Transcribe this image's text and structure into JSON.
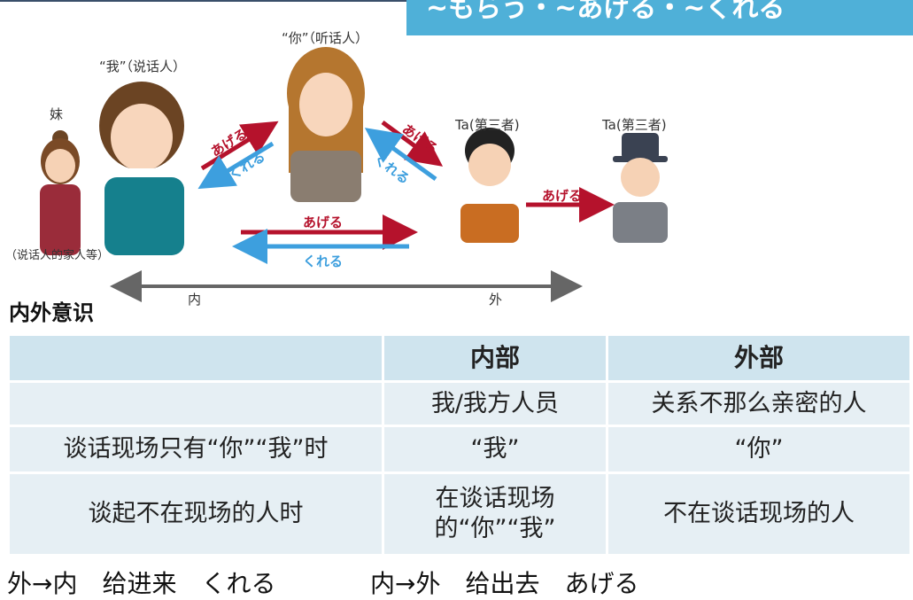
{
  "banner": {
    "title": "~もらう・~あげる・~くれる"
  },
  "figure": {
    "person_sister": "妹",
    "person_sister_note": "（说话人的家人等）",
    "person_me": "“我”（说话人）",
    "person_you": "“你”（听话人）",
    "person_third_1": "Ta(第三者)",
    "person_third_2": "Ta(第三者)",
    "arrow_ageru_1": "あげる",
    "arrow_kureru_1": "くれる",
    "arrow_ageru_2": "あげる",
    "arrow_kureru_2": "くれる",
    "arrow_ageru_3": "あげる",
    "arrow_kureru_3": "くれる",
    "arrow_ageru_4": "あげる",
    "scale_inner": "内",
    "scale_outer": "外"
  },
  "section_title": "内外意识",
  "table": {
    "headers": [
      "",
      "内部",
      "外部"
    ],
    "rows": [
      [
        "",
        "我/我方人员",
        "关系不那么亲密的人"
      ],
      [
        "谈话现场只有“你”“我”时",
        "“我”",
        "“你”"
      ],
      [
        "谈起不在现场的人时",
        "在谈话现场的“你”“我”",
        "不在谈话现场的人"
      ]
    ]
  },
  "footer": {
    "left": "外→内　给进来　くれる",
    "right": "内→外　给出去　あげる"
  },
  "colors": {
    "banner": "#4fb0d8",
    "ageru": "#b5122c",
    "kureru": "#3d9fde",
    "table_head": "#cfe4ee",
    "table_cell": "#e6eff4"
  }
}
